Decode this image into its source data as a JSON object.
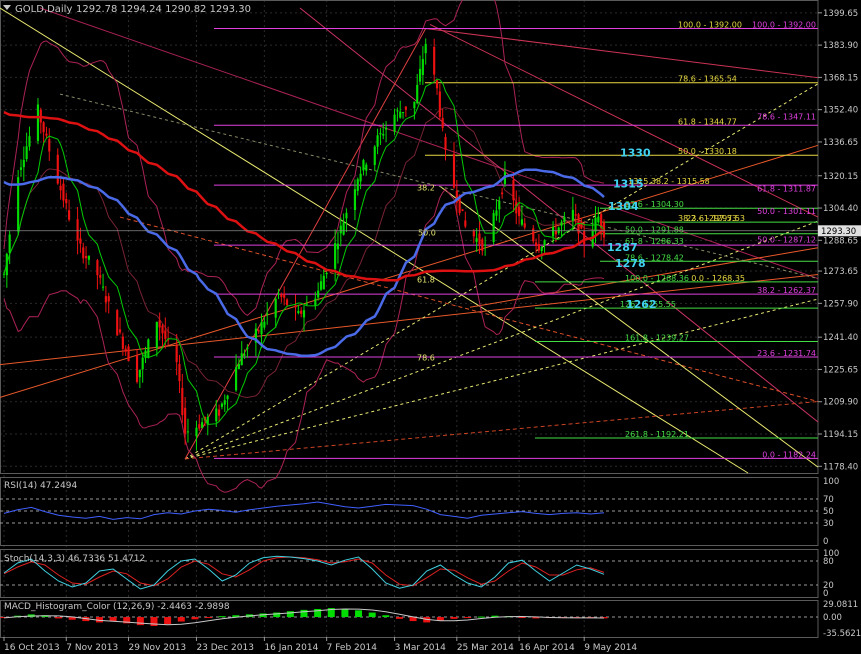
{
  "window": {
    "symbol_label": "GOLD,Daily",
    "ohlc": "1292.78 1294.24 1290.82 1293.30",
    "last_price": "1293.30"
  },
  "colors": {
    "bull": "#00dd00",
    "bear": "#ee1111",
    "ma_fast": "#00cc00",
    "ma_mid": "#4a6ae8",
    "ma_slow": "#dd1111",
    "bands": "#aa2255",
    "fib_main": "#e040e0",
    "fib_yellow": "#e8d840",
    "fib_green": "#44dd44",
    "fan": "#e8e870",
    "price_box": "#e0e0e0"
  },
  "chart_data": [
    {
      "type": "candlestick",
      "title": "GOLD,Daily",
      "ylim": [
        1180,
        1402
      ],
      "y_ticks": [
        "1399.65",
        "1383.90",
        "1368.15",
        "1352.40",
        "1336.65",
        "1320.15",
        "1304.40",
        "1288.65",
        "1273.65",
        "1257.90",
        "1241.40",
        "1225.65",
        "1209.90",
        "1194.15",
        "1178.40"
      ],
      "x_labels": [
        "16 Oct 2013",
        "7 Nov 2013",
        "29 Nov 2013",
        "23 Dec 2013",
        "16 Jan 2014",
        "7 Feb 2014",
        "3 Mar 2014",
        "25 Mar 2014",
        "16 Apr 2014",
        "9 May 2014"
      ],
      "anchors": [
        {
          "date": "16 Oct 2013",
          "price": 1272
        },
        {
          "date": "21 Oct 2013",
          "price": 1322
        },
        {
          "date": "28 Oct 2013",
          "price": 1352
        },
        {
          "date": "4 Nov 2013",
          "price": 1318
        },
        {
          "date": "11 Nov 2013",
          "price": 1287
        },
        {
          "date": "18 Nov 2013",
          "price": 1272
        },
        {
          "date": "25 Nov 2013",
          "price": 1245
        },
        {
          "date": "2 Dec 2013",
          "price": 1222
        },
        {
          "date": "9 Dec 2013",
          "price": 1250
        },
        {
          "date": "16 Dec 2013",
          "price": 1228
        },
        {
          "date": "19 Dec 2013",
          "price": 1195
        },
        {
          "date": "23 Dec 2013",
          "price": 1198
        },
        {
          "date": "31 Dec 2013",
          "price": 1205
        },
        {
          "date": "7 Jan 2014",
          "price": 1230
        },
        {
          "date": "14 Jan 2014",
          "price": 1245
        },
        {
          "date": "21 Jan 2014",
          "price": 1262
        },
        {
          "date": "28 Jan 2014",
          "price": 1252
        },
        {
          "date": "4 Feb 2014",
          "price": 1264
        },
        {
          "date": "11 Feb 2014",
          "price": 1290
        },
        {
          "date": "18 Feb 2014",
          "price": 1320
        },
        {
          "date": "25 Feb 2014",
          "price": 1338
        },
        {
          "date": "3 Mar 2014",
          "price": 1350
        },
        {
          "date": "10 Mar 2014",
          "price": 1356
        },
        {
          "date": "14 Mar 2014",
          "price": 1385
        },
        {
          "date": "18 Mar 2014",
          "price": 1362
        },
        {
          "date": "21 Mar 2014",
          "price": 1330
        },
        {
          "date": "28 Mar 2014",
          "price": 1295
        },
        {
          "date": "4 Apr 2014",
          "price": 1285
        },
        {
          "date": "11 Apr 2014",
          "price": 1319
        },
        {
          "date": "16 Apr 2014",
          "price": 1299
        },
        {
          "date": "23 Apr 2014",
          "price": 1286
        },
        {
          "date": "30 Apr 2014",
          "price": 1295
        },
        {
          "date": "5 May 2014",
          "price": 1302
        },
        {
          "date": "9 May 2014",
          "price": 1288
        },
        {
          "date": "14 May 2014",
          "price": 1300
        },
        {
          "date": "16 May 2014",
          "price": 1293
        }
      ],
      "horizontal_levels": [
        {
          "text": "100.0 - 1392.00",
          "price": 1392.0,
          "color": "fib_yellow",
          "line": "fib_main"
        },
        {
          "text": "100.0 - 1392.00",
          "price": 1392.0,
          "color": "fib_main",
          "at": "right"
        },
        {
          "text": "78.6 - 1365.54",
          "price": 1365.54,
          "color": "fib_yellow",
          "line": "fib_yellow"
        },
        {
          "text": "61.8 - 1344.77",
          "price": 1344.77,
          "color": "fib_yellow",
          "line": "fib_main"
        },
        {
          "text": "78.6 - 1347.11",
          "price": 1347.11,
          "color": "fib_main",
          "at": "right"
        },
        {
          "text": "50.0 - 1330.18",
          "price": 1330.18,
          "color": "fib_yellow",
          "line": "fib_yellow"
        },
        {
          "text": "1315.38.2 - 1315.58",
          "price": 1315.58,
          "color": "fib_yellow",
          "line": "fib_main"
        },
        {
          "text": "61.8 - 1311.87",
          "price": 1311.87,
          "color": "fib_main",
          "at": "right"
        },
        {
          "text": "23.6 - 1304.30",
          "price": 1304.3,
          "color": "fib_green",
          "line": "fib_green"
        },
        {
          "text": "50.0 - 1301.11",
          "price": 1301.11,
          "color": "fib_main",
          "at": "right"
        },
        {
          "text": "38.2 - 1297.53",
          "price": 1297.53,
          "color": "fib_yellow",
          "line": "fib_green"
        },
        {
          "text": "23.6 - 1297.53",
          "price": 1297.53,
          "color": "fib_yellow",
          "at": "right-inner"
        },
        {
          "text": "50.0 - 1291.88",
          "price": 1291.88,
          "color": "fib_green",
          "line": "fib_green"
        },
        {
          "text": "61.8 - 1286.33",
          "price": 1286.33,
          "color": "fib_green",
          "line": "fib_main"
        },
        {
          "text": "50.0 - 1287.12",
          "price": 1287.12,
          "color": "fib_main",
          "at": "right"
        },
        {
          "text": "78.6 - 1278.42",
          "price": 1278.42,
          "color": "fib_green",
          "line": "fib_green"
        },
        {
          "text": "100.0 - 1268.36",
          "price": 1268.36,
          "color": "fib_green",
          "line": "fib_green"
        },
        {
          "text": "0.0 - 1268.35",
          "price": 1268.35,
          "color": "fib_yellow",
          "at": "right-inner"
        },
        {
          "text": "38.2 - 1262.37",
          "price": 1262.37,
          "color": "fib_main",
          "at": "right",
          "line": "fib_main"
        },
        {
          "text": "1262 1255.55",
          "price": 1255.55,
          "color": "fib_green",
          "line": "fib_green"
        },
        {
          "text": "161.8 - 1239.27",
          "price": 1239.27,
          "color": "fib_green",
          "line": "fib_green"
        },
        {
          "text": "23.6 - 1231.74",
          "price": 1231.74,
          "color": "fib_main",
          "at": "right",
          "line": "fib_main"
        },
        {
          "text": "261.8 - 1192.21",
          "price": 1192.21,
          "color": "fib_green",
          "line": "fib_green"
        },
        {
          "text": "0.0 - 1182.24",
          "price": 1182.24,
          "color": "fib_main",
          "at": "right",
          "line": "fib_main"
        }
      ],
      "callouts": [
        {
          "text": "1330",
          "price": 1330
        },
        {
          "text": "1315",
          "price": 1315
        },
        {
          "text": "1304",
          "price": 1304
        },
        {
          "text": "1287",
          "price": 1284
        },
        {
          "text": "1278",
          "price": 1276
        },
        {
          "text": "1262",
          "price": 1256
        }
      ],
      "fan_labels": [
        {
          "text": "38.2",
          "price": 1313
        },
        {
          "text": "50.0",
          "price": 1291
        },
        {
          "text": "61.8",
          "price": 1268
        },
        {
          "text": "78.6",
          "price": 1230
        }
      ]
    },
    {
      "type": "line",
      "title": "RSI(14) 47.2494",
      "ylim": [
        0,
        100
      ],
      "y_ticks": [
        "100",
        "70",
        "50",
        "30",
        "0"
      ],
      "levels": [
        70,
        50,
        30
      ],
      "series": [
        {
          "name": "RSI(14)",
          "values": [
            46,
            52,
            56,
            49,
            43,
            40,
            38,
            41,
            36,
            39,
            37,
            44,
            47,
            45,
            50,
            53,
            51,
            48,
            52,
            55,
            58,
            60,
            62,
            65,
            61,
            57,
            55,
            58,
            61,
            60,
            59,
            53,
            44,
            41,
            38,
            43,
            45,
            47,
            49,
            46,
            44,
            46,
            47,
            45,
            47.2
          ]
        }
      ]
    },
    {
      "type": "line",
      "title": "Stoch(14,3,3) 46.7336 51.4712",
      "ylim": [
        0,
        100
      ],
      "y_ticks": [
        "100",
        "80",
        "20",
        "0"
      ],
      "levels": [
        80,
        20
      ],
      "series": [
        {
          "name": "Stoch main",
          "values": [
            50,
            75,
            85,
            55,
            30,
            15,
            25,
            55,
            60,
            35,
            10,
            20,
            55,
            80,
            85,
            60,
            30,
            45,
            75,
            88,
            92,
            90,
            86,
            80,
            70,
            82,
            90,
            60,
            25,
            12,
            20,
            55,
            70,
            45,
            25,
            15,
            40,
            75,
            82,
            55,
            30,
            50,
            70,
            60,
            46.7
          ]
        },
        {
          "name": "Stoch signal",
          "values": [
            48,
            65,
            78,
            70,
            45,
            25,
            22,
            40,
            55,
            48,
            25,
            18,
            35,
            65,
            80,
            72,
            48,
            40,
            58,
            80,
            88,
            90,
            88,
            83,
            75,
            78,
            85,
            75,
            45,
            22,
            18,
            38,
            60,
            57,
            38,
            22,
            30,
            55,
            75,
            65,
            45,
            45,
            58,
            63,
            51.5
          ]
        }
      ]
    },
    {
      "type": "bar",
      "title": "MACD_Histogram_Color (12,26,9) -2.4463 -2.9898",
      "y_ticks": [
        "29.0811",
        "0.00",
        "-35.5621"
      ],
      "ylim": [
        -35.5621,
        29.0811
      ],
      "series": [
        {
          "name": "histogram",
          "values": [
            -2,
            3,
            6,
            4,
            -3,
            -6,
            -9,
            -12,
            -10,
            -14,
            -18,
            -20,
            -16,
            -10,
            -5,
            -2,
            2,
            4,
            6,
            8,
            10,
            13,
            16,
            18,
            20,
            18,
            15,
            10,
            4,
            -4,
            -9,
            -12,
            -8,
            -4,
            -2,
            1,
            3,
            2,
            -1,
            -3,
            -2,
            -1,
            -2,
            -2.4,
            -2.9
          ]
        }
      ]
    }
  ]
}
